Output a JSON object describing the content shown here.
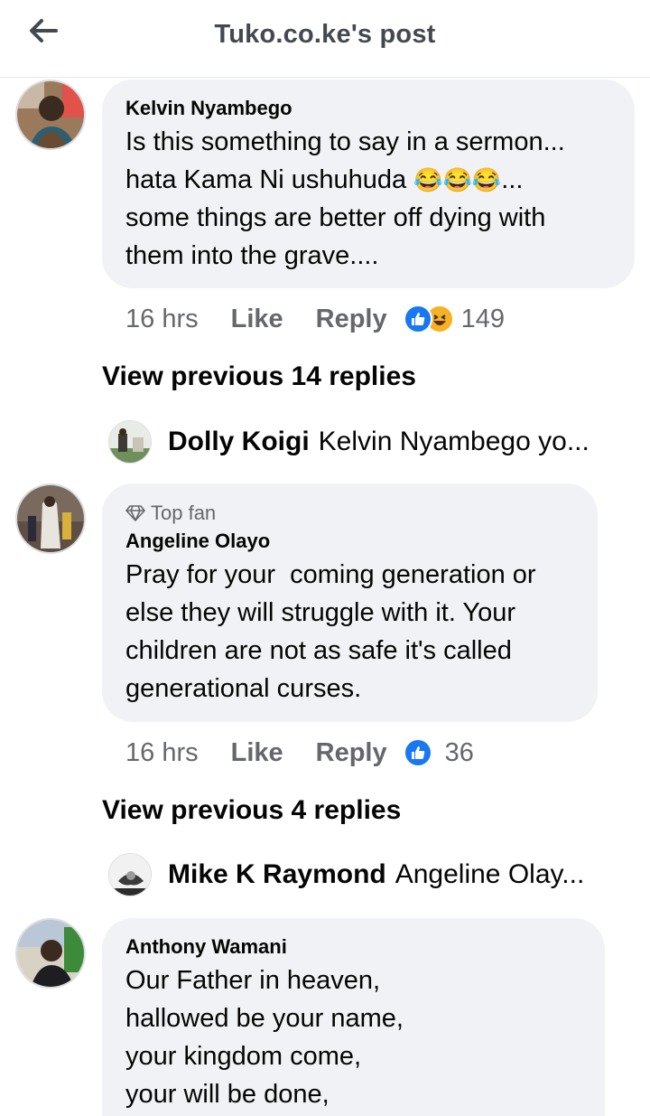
{
  "header": {
    "title": "Tuko.co.ke's post"
  },
  "comments": [
    {
      "author": "Kelvin Nyambego",
      "lines": [
        "Is this something to say in a sermon...",
        "hata Kama Ni ushuhuda",
        "some things are better off dying with",
        "them into the grave...."
      ],
      "emojis": "😂😂😂",
      "line2_suffix": "...",
      "time": "16 hrs",
      "like": "Like",
      "reply": "Reply",
      "reaction_count": "149",
      "reactions": [
        "like-icon",
        "haha-icon"
      ],
      "view_previous": "View previous 14 replies",
      "latest_reply": {
        "name": "Dolly Koigi",
        "text": "Kelvin Nyambego yo..."
      }
    },
    {
      "badge": "Top fan",
      "author": "Angeline Olayo",
      "lines": [
        "Pray for your  coming generation or",
        "else they will struggle with it. Your",
        "children are not as safe it's called",
        "generational curses."
      ],
      "time": "16 hrs",
      "like": "Like",
      "reply": "Reply",
      "reaction_count": "36",
      "reactions": [
        "like-icon"
      ],
      "view_previous": "View previous 4 replies",
      "latest_reply": {
        "name": "Mike K Raymond",
        "text": "Angeline Olay..."
      }
    },
    {
      "author": "Anthony Wamani",
      "lines": [
        "Our Father in heaven,",
        "hallowed be your name,",
        "your kingdom come,",
        "your will be done,"
      ]
    }
  ],
  "colors": {
    "like_blue": "#1877f2",
    "haha_yellow": "#f7b125",
    "bubble": "#f0f2f5",
    "secondary_text": "#65676b"
  }
}
